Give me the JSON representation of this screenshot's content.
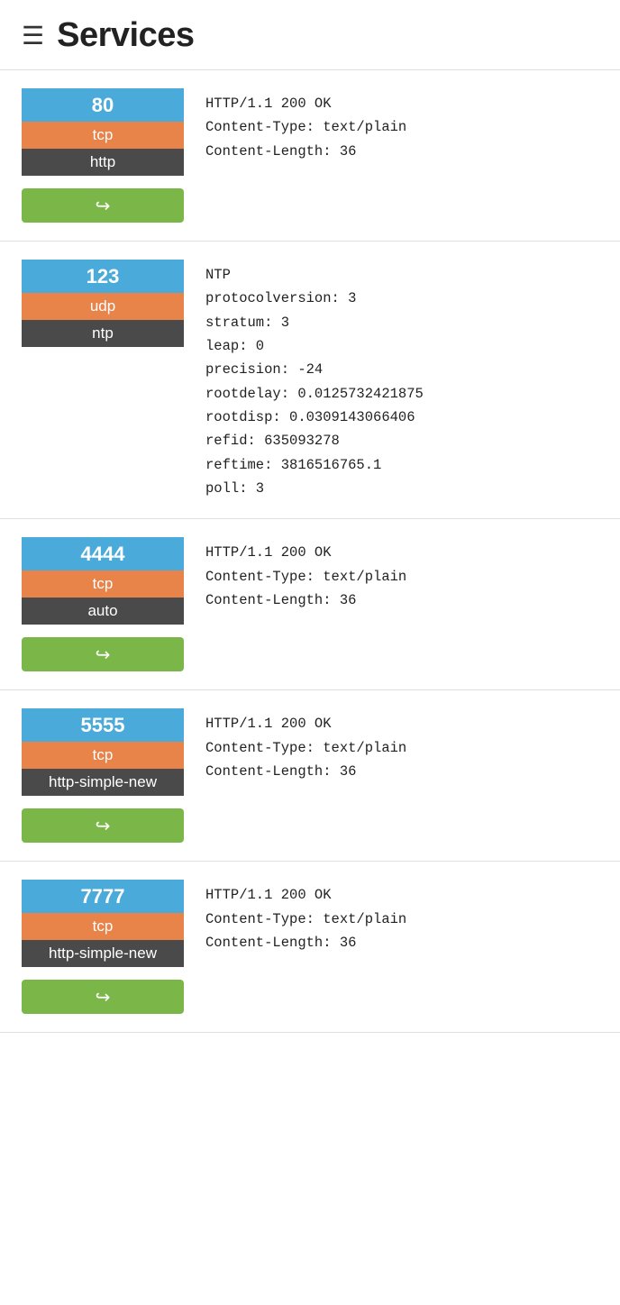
{
  "header": {
    "title": "Services",
    "icon": "☰"
  },
  "services": [
    {
      "port": "80",
      "protocol": "tcp",
      "name": "http",
      "info": "HTTP/1.1 200 OK\nContent-Type: text/plain\nContent-Length: 36",
      "has_action": true,
      "action_icon": "↪"
    },
    {
      "port": "123",
      "protocol": "udp",
      "name": "ntp",
      "info": "NTP\nprotocolversion: 3\nstratum: 3\nleap: 0\nprecision: -24\nrootdelay: 0.0125732421875\nrootdisp: 0.0309143066406\nrefid: 635093278\nreftime: 3816516765.1\npoll: 3",
      "has_action": false,
      "action_icon": ""
    },
    {
      "port": "4444",
      "protocol": "tcp",
      "name": "auto",
      "info": "HTTP/1.1 200 OK\nContent-Type: text/plain\nContent-Length: 36",
      "has_action": true,
      "action_icon": "↪"
    },
    {
      "port": "5555",
      "protocol": "tcp",
      "name": "http-simple-new",
      "info": "HTTP/1.1 200 OK\nContent-Type: text/plain\nContent-Length: 36",
      "has_action": true,
      "action_icon": "↪"
    },
    {
      "port": "7777",
      "protocol": "tcp",
      "name": "http-simple-new",
      "info": "HTTP/1.1 200 OK\nContent-Type: text/plain\nContent-Length: 36",
      "has_action": true,
      "action_icon": "↪"
    }
  ],
  "colors": {
    "port_bg": "#4aabdb",
    "protocol_bg": "#e8834a",
    "name_bg": "#4a4a4a",
    "action_bg": "#7ab648"
  }
}
